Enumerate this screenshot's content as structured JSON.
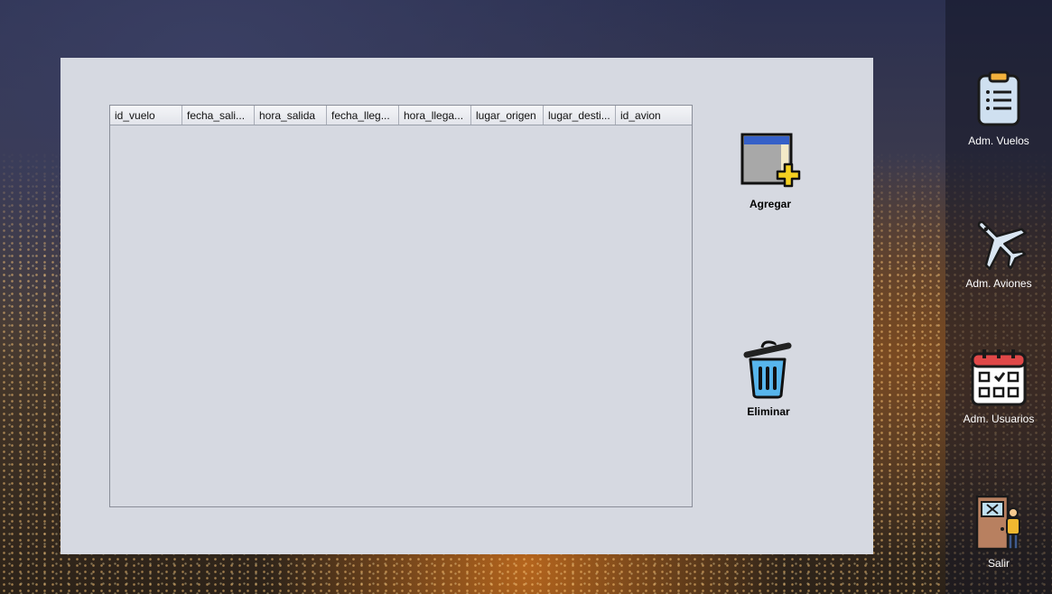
{
  "table": {
    "columns": [
      "id_vuelo",
      "fecha_sali...",
      "hora_salida",
      "fecha_lleg...",
      "hora_llega...",
      "lugar_origen",
      "lugar_desti...",
      "id_avion"
    ],
    "rows": []
  },
  "actions": {
    "add_label": "Agregar",
    "delete_label": "Eliminar"
  },
  "sidebar": {
    "items": [
      {
        "label": "Adm. Vuelos",
        "icon": "clipboard-icon"
      },
      {
        "label": "Adm. Aviones",
        "icon": "airplane-icon"
      },
      {
        "label": "Adm. Usuarios",
        "icon": "calendar-icon"
      },
      {
        "label": "Salir",
        "icon": "exit-door-icon"
      }
    ]
  }
}
